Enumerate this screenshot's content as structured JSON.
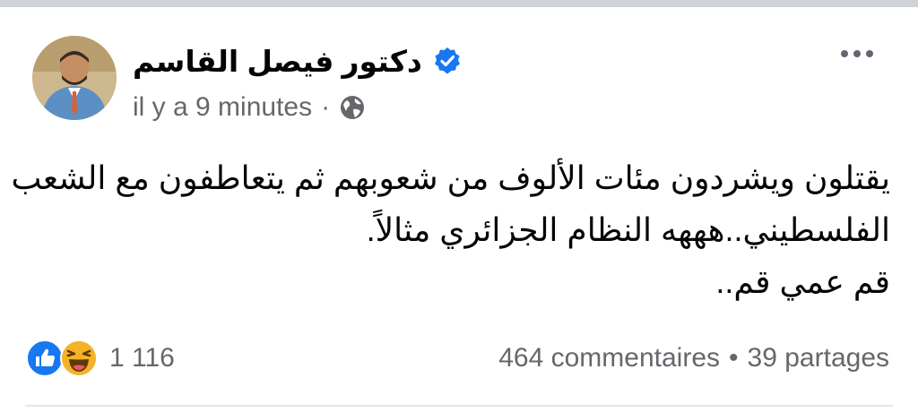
{
  "post": {
    "author_name": "دكتور فيصل القاسم",
    "verified": true,
    "timestamp": "il y a 9 minutes",
    "separator": "·",
    "privacy_icon": "globe-icon",
    "text_lines": [
      "يقتلون ويشردون مئات الألوف من شعوبهم ثم يتعاطفون مع الشعب",
      "الفلسطيني..هههه النظام الجزائري مثالاً.",
      "قم عمي قم.."
    ]
  },
  "reactions": {
    "icons": [
      "like-icon",
      "haha-icon"
    ],
    "count": "1 116"
  },
  "stats": {
    "comments": "464 commentaires",
    "separator": "•",
    "shares": "39 partages"
  },
  "colors": {
    "accent": "#1877f2",
    "secondary_text": "#65676b",
    "haha_yellow": "#f7b125"
  }
}
